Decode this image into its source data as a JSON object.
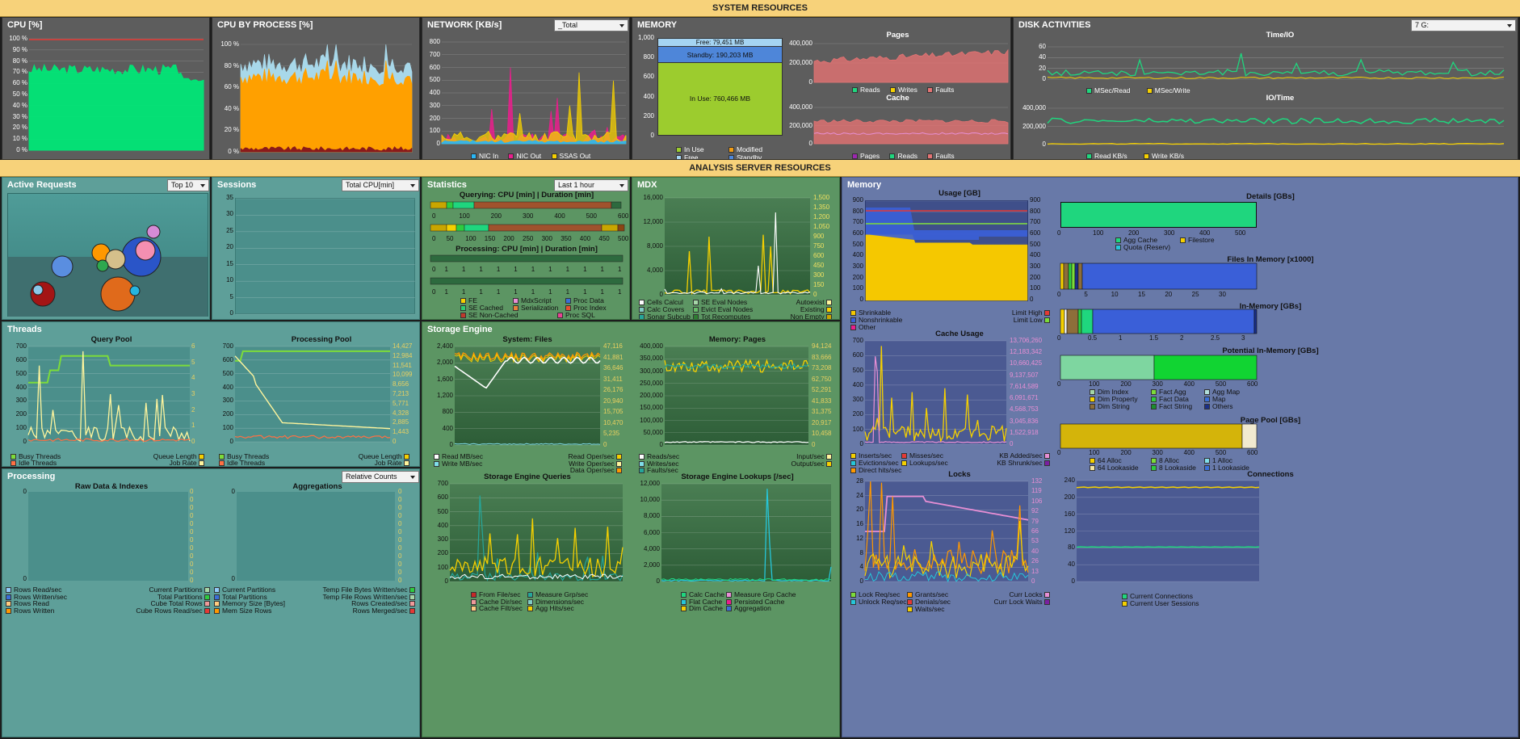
{
  "bands": {
    "system": "SYSTEM RESOURCES",
    "analysis": "ANALYSIS SERVER RESOURCES"
  },
  "cpu": {
    "title": "CPU [%]",
    "yticks": [
      "100 %",
      "90 %",
      "80 %",
      "70 %",
      "60 %",
      "50 %",
      "40 %",
      "30 %",
      "20 %",
      "10 %",
      "0 %"
    ],
    "color": "#00e676"
  },
  "cpu_proc": {
    "title": "CPU BY PROCESS [%]",
    "yticks": [
      "100 %",
      "80 %",
      "60 %",
      "40 %",
      "20 %",
      "0 %"
    ]
  },
  "network": {
    "title": "NETWORK [KB/s]",
    "select": "_Total",
    "yticks": [
      "800",
      "700",
      "600",
      "500",
      "400",
      "300",
      "200",
      "100",
      "0"
    ],
    "legend": [
      "NIC In",
      "NIC Out",
      "SSAS Out"
    ]
  },
  "memory_sys": {
    "title": "MEMORY",
    "free_label": "Free: 79,451 MB",
    "standby_label": "Standby: 190,203 MB",
    "inuse_label": "In Use: 760,466 MB",
    "yticks": [
      "1,000",
      "800",
      "600",
      "400",
      "200",
      "0"
    ],
    "legend": [
      "In Use",
      "Modified",
      "Free",
      "Standby"
    ],
    "pages_title": "Pages",
    "pages_yticks": [
      "400,000",
      "200,000",
      "0"
    ],
    "pages_legend": [
      "Reads",
      "Writes",
      "Faults"
    ],
    "cache_title": "Cache",
    "cache_yticks": [
      "400,000",
      "200,000",
      "0"
    ],
    "cache_legend": [
      "Pages",
      "Reads",
      "Faults"
    ]
  },
  "disk": {
    "title": "DISK ACTIVITIES",
    "select": "7 G:",
    "timeio_title": "Time/IO",
    "timeio_yticks": [
      "60",
      "40",
      "20",
      "0"
    ],
    "timeio_legend": [
      "MSec/Read",
      "MSec/Write"
    ],
    "iotime_title": "IO/Time",
    "iotime_yticks": [
      "400,000",
      "200,000",
      "0"
    ],
    "iotime_legend": [
      "Read KB/s",
      "Write KB/s"
    ]
  },
  "active_requests": {
    "title": "Active Requests",
    "select": "Top 10"
  },
  "sessions": {
    "title": "Sessions",
    "select": "Total CPU[min]",
    "yticks": [
      "35",
      "30",
      "25",
      "20",
      "15",
      "10",
      "5",
      "0"
    ]
  },
  "statistics": {
    "title": "Statistics",
    "select": "Last 1 hour",
    "querying_title": "Querying: CPU [min]  |  Duration [min]",
    "q_ticks1": [
      "0",
      "100",
      "200",
      "300",
      "400",
      "500",
      "600"
    ],
    "q_ticks2": [
      "0",
      "50",
      "100",
      "150",
      "200",
      "250",
      "300",
      "350",
      "400",
      "450",
      "500"
    ],
    "processing_title": "Processing: CPU [min]  |  Duration [min]",
    "p_ticks": [
      "0",
      "1",
      "1",
      "1",
      "1",
      "1",
      "1",
      "1",
      "1",
      "1",
      "1",
      "1"
    ],
    "legend": [
      "FE",
      "MdxScript",
      "Proc Data",
      "SE Cached",
      "Serialization",
      "Proc Index",
      "SE Non-Cached",
      "Proc SQL"
    ]
  },
  "mdx": {
    "title": "MDX",
    "yticks": [
      "16,000",
      "12,000",
      "8,000",
      "4,000",
      "0"
    ],
    "ryticks": [
      "1,500",
      "1,350",
      "1,200",
      "1,050",
      "900",
      "750",
      "600",
      "450",
      "300",
      "150",
      "0"
    ],
    "legend_left": [
      "Cells Calcul",
      "Calc Covers",
      "Sonar Subcub"
    ],
    "legend_mid": [
      "SE Eval Nodes",
      "Evict Eval Nodes",
      "Tot Recomputes"
    ],
    "legend_right": [
      "Autoexist",
      "Existing",
      "Non Empty"
    ]
  },
  "as_memory": {
    "title": "Memory",
    "usage_title": "Usage [GB]",
    "usage_yticks": [
      "900",
      "800",
      "700",
      "600",
      "500",
      "400",
      "300",
      "200",
      "100",
      "0"
    ],
    "usage_legend": [
      "Shrinkable",
      "Nonshrinkable",
      "Other"
    ],
    "usage_legend_r": [
      "Limit High",
      "Limit Low"
    ],
    "cache_title": "Cache Usage",
    "cache_yticks": [
      "700",
      "600",
      "500",
      "400",
      "300",
      "200",
      "100",
      "0"
    ],
    "cache_ryticks": [
      "13,706,260",
      "12,183,342",
      "10,660,425",
      "9,137,507",
      "7,614,589",
      "6,091,671",
      "4,568,753",
      "3,045,836",
      "1,522,918",
      "0"
    ],
    "cache_legend_l": [
      "Inserts/sec",
      "Evictions/sec",
      "Direct hits/sec"
    ],
    "cache_legend_m": [
      "Misses/sec",
      "Lookups/sec"
    ],
    "cache_legend_r": [
      "KB Added/sec",
      "KB Shrunk/sec"
    ],
    "locks_title": "Locks",
    "locks_yticks": [
      "28",
      "24",
      "20",
      "16",
      "12",
      "8",
      "4",
      "0"
    ],
    "locks_ryticks": [
      "132",
      "119",
      "106",
      "92",
      "79",
      "66",
      "53",
      "40",
      "26",
      "13",
      "0"
    ],
    "locks_legend_l": [
      "Lock Req/sec",
      "Unlock Req/sec"
    ],
    "locks_legend_m": [
      "Grants/sec",
      "Denials/sec",
      "Waits/sec"
    ],
    "locks_legend_r": [
      "Curr Locks",
      "Curr Lock Waits"
    ],
    "details_title": "Details [GBs]",
    "details_ticks": [
      "0",
      "100",
      "200",
      "300",
      "400",
      "500"
    ],
    "details_legend": [
      "Agg Cache",
      "Filestore",
      "Quota (Reserv)"
    ],
    "files_title": "Files In Memory [x1000]",
    "files_ticks": [
      "0",
      "5",
      "10",
      "15",
      "20",
      "25",
      "30"
    ],
    "inmem_title": "In-Memory [GBs]",
    "inmem_ticks": [
      "0",
      "0.5",
      "1",
      "1.5",
      "2",
      "2.5",
      "3"
    ],
    "potential_title": "Potential In-Memory [GBs]",
    "potential_ticks": [
      "0",
      "100",
      "200",
      "300",
      "400",
      "500",
      "600"
    ],
    "potential_legend": [
      "Dim Index",
      "Fact Agg",
      "Agg Map",
      "Dim Property",
      "Fact Data",
      "Map",
      "Dim String",
      "Fact String",
      "Others"
    ],
    "pagepool_title": "Page Pool [GBs]",
    "pagepool_ticks": [
      "0",
      "100",
      "200",
      "300",
      "400",
      "500",
      "600"
    ],
    "pagepool_legend": [
      "64 Alloc",
      "8 Alloc",
      "1 Alloc",
      "64 Lookaside",
      "8 Lookaside",
      "1 Lookaside"
    ],
    "conn_title": "Connections",
    "conn_yticks": [
      "240",
      "200",
      "160",
      "120",
      "80",
      "40",
      "0"
    ],
    "conn_legend": [
      "Current Connections",
      "Current User Sessions"
    ]
  },
  "threads": {
    "title": "Threads",
    "qp_title": "Query Pool",
    "qp_yticks": [
      "700",
      "600",
      "500",
      "400",
      "300",
      "200",
      "100",
      "0"
    ],
    "qp_ryticks": [
      "6",
      "5",
      "4",
      "3",
      "2",
      "1",
      "0"
    ],
    "qp_legend_l": [
      "Busy Threads",
      "Idle Threads"
    ],
    "qp_legend_r": [
      "Queue Length",
      "Job Rate"
    ],
    "pp_title": "Processing Pool",
    "pp_yticks": [
      "700",
      "600",
      "500",
      "400",
      "300",
      "200",
      "100",
      "0"
    ],
    "pp_ryticks": [
      "14,427",
      "12,984",
      "11,541",
      "10,099",
      "8,656",
      "7,213",
      "5,771",
      "4,328",
      "2,885",
      "1,443",
      "0"
    ],
    "pp_legend_l": [
      "Busy Threads",
      "Idle Threads"
    ],
    "pp_legend_r": [
      "Queue Length",
      "Job Rate"
    ]
  },
  "processing": {
    "title": "Processing",
    "select": "Relative Counts",
    "raw_title": "Raw Data            &            Indexes",
    "agg_title": "Aggregations",
    "ticks0": [
      "0",
      "0",
      "0",
      "0",
      "0",
      "0",
      "0",
      "0",
      "0",
      "0",
      "0",
      "0"
    ],
    "legend_l": [
      "Rows Read/sec",
      "Rows Written/sec",
      "Rows Read",
      "Rows Written"
    ],
    "legend_m": [
      "Current Partitions",
      "Total Partitions",
      "Cube Total Rows",
      "Cube Rows Read/sec"
    ],
    "legend_m2": [
      "Current Partitions",
      "Total Partitions",
      "Memory Size [Bytes]",
      "Mem Size Rows"
    ],
    "legend_r": [
      "Temp File Bytes Written/sec",
      "Temp File Rows Written/sec",
      "Rows Created/sec",
      "Rows Merged/sec"
    ]
  },
  "storage": {
    "title": "Storage Engine",
    "files_title": "System: Files",
    "files_yticks": [
      "2,400",
      "2,000",
      "1,600",
      "1,200",
      "800",
      "400",
      "0"
    ],
    "files_ryticks": [
      "47,116",
      "41,881",
      "36,646",
      "31,411",
      "26,176",
      "20,940",
      "15,705",
      "10,470",
      "5,235",
      "0"
    ],
    "files_legend_l": [
      "Read MB/sec",
      "Write MB/sec"
    ],
    "files_legend_r": [
      "Read Oper/sec",
      "Write Oper/sec",
      "Data Oper/sec"
    ],
    "mem_title": "Memory: Pages",
    "mem_yticks": [
      "400,000",
      "350,000",
      "300,000",
      "250,000",
      "200,000",
      "150,000",
      "100,000",
      "50,000",
      "0"
    ],
    "mem_ryticks": [
      "94,124",
      "83,666",
      "73,208",
      "62,750",
      "52,291",
      "41,833",
      "31,375",
      "20,917",
      "10,458",
      "0"
    ],
    "mem_legend_l": [
      "Reads/sec",
      "Writes/sec",
      "Faults/sec"
    ],
    "mem_legend_r": [
      "Input/sec",
      "Output/sec"
    ],
    "q_title": "Storage Engine Queries",
    "q_yticks": [
      "700",
      "600",
      "500",
      "400",
      "300",
      "200",
      "100",
      "0"
    ],
    "q_legend_l": [
      "From File/sec",
      "Cache Dir/sec",
      "Cache Filt/sec"
    ],
    "q_legend_r": [
      "Measure Grp/sec",
      "Dimensions/sec",
      "Agg Hits/sec"
    ],
    "l_title": "Storage Engine Lookups [/sec]",
    "l_yticks": [
      "12,000",
      "10,000",
      "8,000",
      "6,000",
      "4,000",
      "2,000",
      "0"
    ],
    "l_legend_l": [
      "Calc Cache",
      "Flat Cache",
      "Dim Cache"
    ],
    "l_legend_r": [
      "Measure Grp Cache",
      "Persisted Cache",
      "Aggregation"
    ]
  }
}
